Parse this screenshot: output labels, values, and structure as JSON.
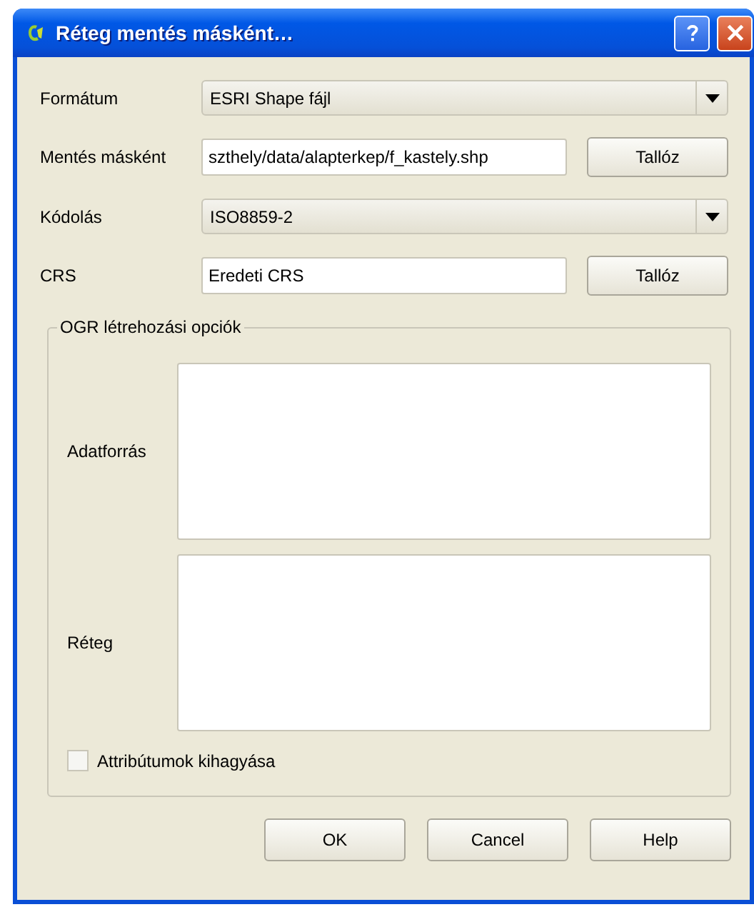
{
  "window": {
    "title": "Réteg mentés másként…"
  },
  "fields": [
    {
      "kind": "combo",
      "label": "Formátum",
      "value": "ESRI Shape fájl"
    },
    {
      "kind": "text",
      "label": "Mentés másként",
      "value": "szthely/data/alapterkep/f_kastely.shp",
      "button": "Tallóz"
    },
    {
      "kind": "combo",
      "label": "Kódolás",
      "value": "ISO8859-2"
    },
    {
      "kind": "text",
      "label": "CRS",
      "value": "Eredeti CRS",
      "button": "Tallóz"
    }
  ],
  "group": {
    "title": "OGR létrehozási opciók",
    "areas": [
      {
        "label": "Adatforrás"
      },
      {
        "label": "Réteg"
      }
    ],
    "checkbox": {
      "label": "Attribútumok kihagyása",
      "checked": false
    }
  },
  "buttons": [
    "OK",
    "Cancel",
    "Help"
  ]
}
